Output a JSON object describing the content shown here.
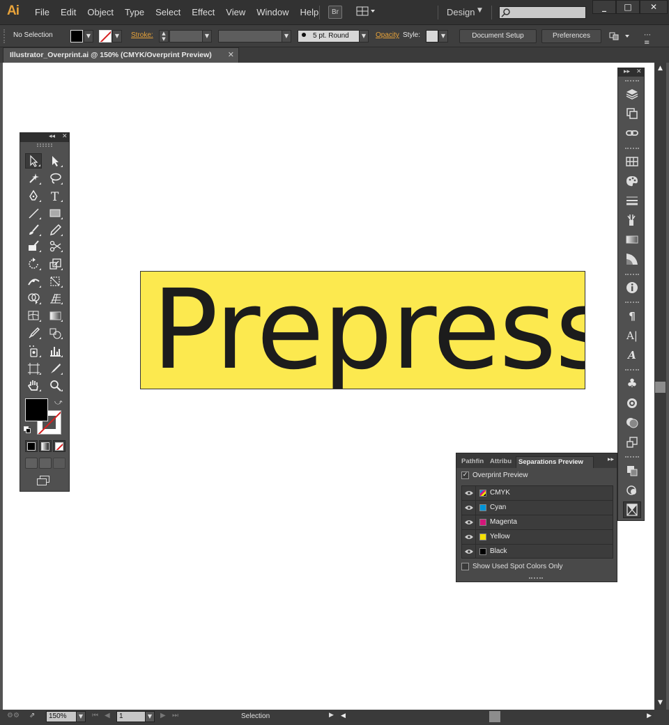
{
  "app": {
    "logo": "Ai",
    "menus": [
      "File",
      "Edit",
      "Object",
      "Type",
      "Select",
      "Effect",
      "View",
      "Window",
      "Help"
    ],
    "bridge_label": "Br",
    "workspace": "Design",
    "window_controls": [
      "_",
      "□",
      "✕"
    ]
  },
  "control_bar": {
    "selection_status": "No Selection",
    "stroke_label": "Stroke:",
    "brush_label": "5 pt. Round",
    "opacity_label": "Opacity",
    "style_label": "Style:",
    "document_setup_label": "Document Setup",
    "preferences_label": "Preferences"
  },
  "document": {
    "tab_title": "Illustrator_Overprint.ai @ 150% (CMYK/Overprint Preview)",
    "artwork_text": "Prepress",
    "artwork_fill": "#fce94f"
  },
  "status_bar": {
    "zoom": "150%",
    "artboard": "1",
    "current_tool": "Selection"
  },
  "separations_panel": {
    "tabs": [
      "Pathfin",
      "Attribu",
      "Separations Preview"
    ],
    "active_tab": "Separations Preview",
    "overprint_preview_label": "Overprint Preview",
    "overprint_preview_checked": true,
    "inks": [
      {
        "name": "CMYK",
        "color": "cmyk"
      },
      {
        "name": "Cyan",
        "color": "#0094d8"
      },
      {
        "name": "Magenta",
        "color": "#d4167a"
      },
      {
        "name": "Yellow",
        "color": "#f5e000"
      },
      {
        "name": "Black",
        "color": "#000000"
      }
    ],
    "spot_only_label": "Show Used Spot Colors Only",
    "spot_only_checked": false
  },
  "colors": {
    "accent": "#e8a33a",
    "fill": "#000000",
    "stroke_none": "#d62020"
  }
}
